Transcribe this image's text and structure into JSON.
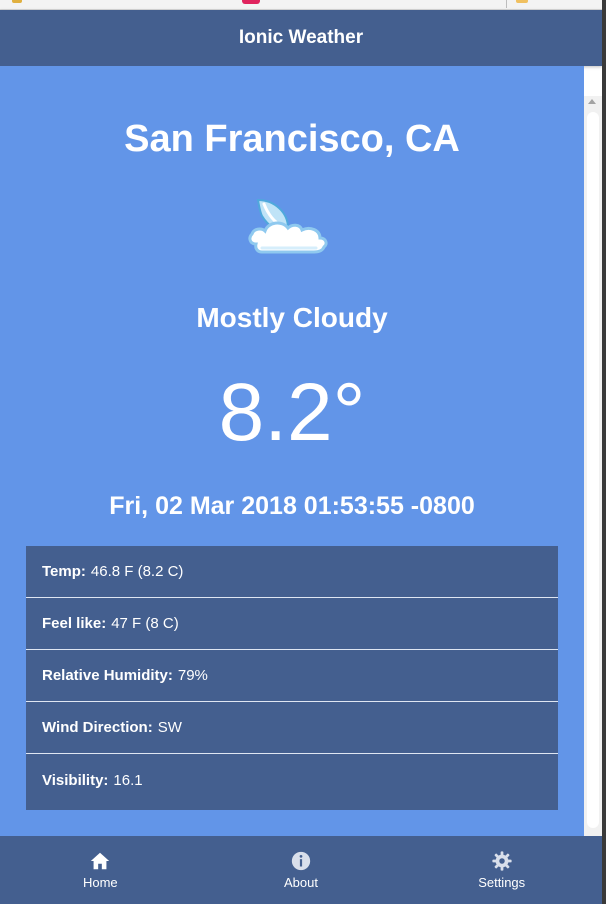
{
  "header": {
    "title": "Ionic Weather"
  },
  "weather": {
    "location": "San Francisco, CA",
    "icon": "partly-cloudy-night-icon",
    "condition": "Mostly Cloudy",
    "temperature": "8.2°",
    "observation_time": "Fri, 02 Mar 2018 01:53:55 -0800"
  },
  "details": [
    {
      "label": "Temp:",
      "value": "46.8 F (8.2 C)"
    },
    {
      "label": "Feel like:",
      "value": "47 F (8 C)"
    },
    {
      "label": "Relative Humidity:",
      "value": "79%"
    },
    {
      "label": "Wind Direction:",
      "value": "SW"
    },
    {
      "label": "Visibility:",
      "value": "16.1"
    }
  ],
  "tabs": [
    {
      "label": "Home",
      "icon": "home-icon"
    },
    {
      "label": "About",
      "icon": "info-icon"
    },
    {
      "label": "Settings",
      "icon": "gear-icon"
    }
  ],
  "colors": {
    "header_bg": "#445f8f",
    "content_bg": "#6295e8",
    "text": "#ffffff"
  }
}
